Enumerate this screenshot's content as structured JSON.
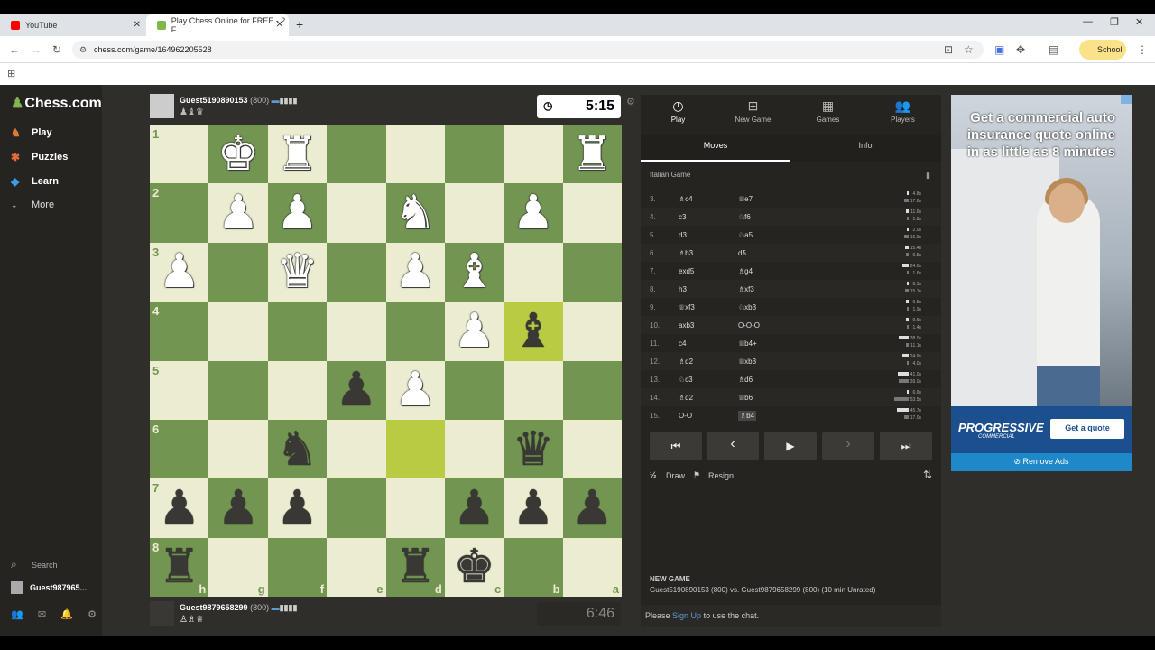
{
  "browser": {
    "tabs": [
      {
        "title": "YouTube"
      },
      {
        "title": "Play Chess Online for FREE - 2 F"
      }
    ],
    "url": "chess.com/game/164962205528",
    "profile_label": "School"
  },
  "sidebar": {
    "logo": "Chess.com",
    "items": [
      {
        "label": "Play",
        "icon": "play-icon"
      },
      {
        "label": "Puzzles",
        "icon": "puzzle-icon"
      },
      {
        "label": "Learn",
        "icon": "learn-icon"
      },
      {
        "label": "More",
        "icon": "chevron-down-icon"
      }
    ],
    "search_label": "Search",
    "user_label": "Guest987965..."
  },
  "top_player": {
    "name": "Guest5190890153",
    "rating": "(800)",
    "captured": "♟♝♛",
    "clock": "5:15"
  },
  "bottom_player": {
    "name": "Guest9879658299",
    "rating": "(800)",
    "captured": "♙♗♕",
    "clock": "6:46"
  },
  "board": {
    "ranks": [
      "1",
      "2",
      "3",
      "4",
      "5",
      "6",
      "7",
      "8"
    ],
    "files": [
      "h",
      "g",
      "f",
      "e",
      "d",
      "c",
      "b",
      "a"
    ],
    "squares": [
      [
        "",
        "wK",
        "wR",
        "",
        "",
        "",
        "",
        "wR"
      ],
      [
        "",
        "wP",
        "wP",
        "",
        "wN",
        "",
        "wP",
        ""
      ],
      [
        "wP",
        "",
        "wQ",
        "",
        "wP",
        "wB",
        "",
        ""
      ],
      [
        "",
        "",
        "",
        "",
        "",
        "wP",
        "bB",
        ""
      ],
      [
        "",
        "",
        "",
        "bP",
        "wP",
        "",
        "",
        ""
      ],
      [
        "",
        "",
        "bN",
        "",
        "",
        "",
        "bQ",
        ""
      ],
      [
        "bP",
        "bP",
        "bP",
        "",
        "",
        "bP",
        "bP",
        "bP"
      ],
      [
        "bR",
        "",
        "",
        "",
        "bR",
        "bK",
        "",
        ""
      ]
    ],
    "highlight": [
      [
        3,
        6
      ],
      [
        5,
        4
      ]
    ]
  },
  "panel": {
    "tabs": [
      {
        "label": "Play",
        "icon": "clock-icon"
      },
      {
        "label": "New Game",
        "icon": "plus-icon"
      },
      {
        "label": "Games",
        "icon": "board-icon"
      },
      {
        "label": "Players",
        "icon": "players-icon"
      }
    ],
    "subtabs": [
      "Moves",
      "Info"
    ],
    "opening": "Italian Game",
    "moves": [
      {
        "n": "3.",
        "w": "♗c4",
        "b": "♕e7",
        "tw": "4.8s",
        "tb": "17.6s"
      },
      {
        "n": "4.",
        "w": "c3",
        "b": "♘f6",
        "tw": "11.6s",
        "tb": "1.8s"
      },
      {
        "n": "5.",
        "w": "d3",
        "b": "♘a5",
        "tw": "2.0s",
        "tb": "16.9s"
      },
      {
        "n": "6.",
        "w": "♗b3",
        "b": "d5",
        "tw": "15.4s",
        "tb": "9.5s"
      },
      {
        "n": "7.",
        "w": "exd5",
        "b": "♗g4",
        "tw": "24.0s",
        "tb": "1.6s"
      },
      {
        "n": "8.",
        "w": "h3",
        "b": "♗xf3",
        "tw": "8.3s",
        "tb": "15.1s"
      },
      {
        "n": "9.",
        "w": "♕xf3",
        "b": "♘xb3",
        "tw": "9.5s",
        "tb": "1.9s"
      },
      {
        "n": "10.",
        "w": "axb3",
        "b": "O-O-O",
        "tw": "9.6s",
        "tb": "1.4s"
      },
      {
        "n": "11.",
        "w": "c4",
        "b": "♕b4+",
        "tw": "38.0s",
        "tb": "11.1s"
      },
      {
        "n": "12.",
        "w": "♗d2",
        "b": "♕xb3",
        "tw": "24.6s",
        "tb": "4.0s"
      },
      {
        "n": "13.",
        "w": "♘c3",
        "b": "♗d6",
        "tw": "41.0s",
        "tb": "39.0s"
      },
      {
        "n": "14.",
        "w": "♗d2",
        "b": "♕b6",
        "tw": "6.6s",
        "tb": "53.5s"
      },
      {
        "n": "15.",
        "w": "O-O",
        "b": "♗b4",
        "tw": "45.7s",
        "tb": "17.0s"
      }
    ],
    "controls": [
      "⏮",
      "‹",
      "▶",
      "›",
      "⏭"
    ],
    "draw_label": "Draw",
    "resign_label": "Resign",
    "newgame_title": "NEW GAME",
    "newgame_desc": "Guest5190890153 (800) vs. Guest9879658299 (800) (10 min Unrated)",
    "chat_prefix": "Please ",
    "chat_link": "Sign Up",
    "chat_suffix": " to use the chat."
  },
  "ad": {
    "headline": "Get a commercial auto insurance quote online in as little as 8 minutes",
    "brand": "PROGRESSIVE",
    "brand_sub": "COMMERCIAL",
    "cta": "Get a quote",
    "remove": "Remove Ads"
  },
  "colors": {
    "light_square": "#ebecd0",
    "dark_square": "#739552",
    "accent": "#81b64c"
  }
}
